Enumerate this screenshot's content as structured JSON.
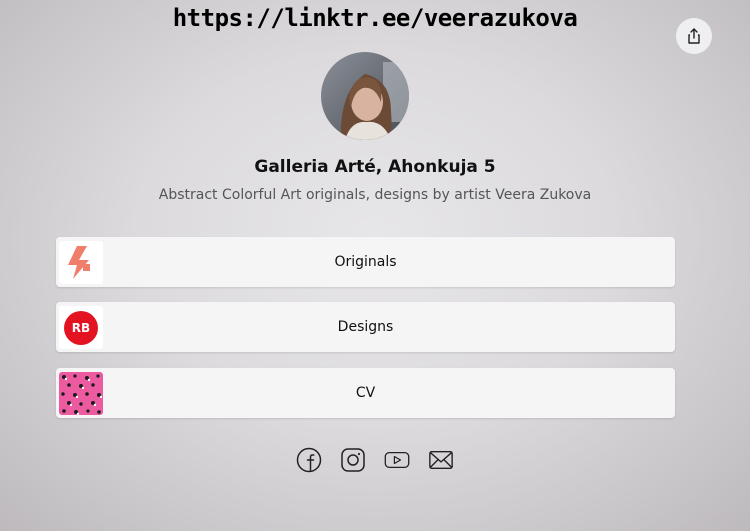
{
  "url_overlay": "https://linktr.ee/veerazukova",
  "profile": {
    "name": "Galleria Arté, Ahonkuja 5",
    "bio": "Abstract Colorful Art originals, designs by artist Veera Zukova"
  },
  "links": [
    {
      "label": "Originals",
      "thumb_icon": "originals-logo-icon"
    },
    {
      "label": "Designs",
      "thumb_icon": "redbubble-logo-icon",
      "thumb_text": "RB"
    },
    {
      "label": "CV",
      "thumb_icon": "pink-pattern-thumbnail"
    }
  ],
  "socials": [
    {
      "icon": "facebook-icon"
    },
    {
      "icon": "instagram-icon"
    },
    {
      "icon": "youtube-icon"
    },
    {
      "icon": "email-icon"
    }
  ],
  "colors": {
    "originals_accent": "#ef7e6d",
    "redbubble_red": "#e41321",
    "cv_pink": "#ec5aa0"
  }
}
